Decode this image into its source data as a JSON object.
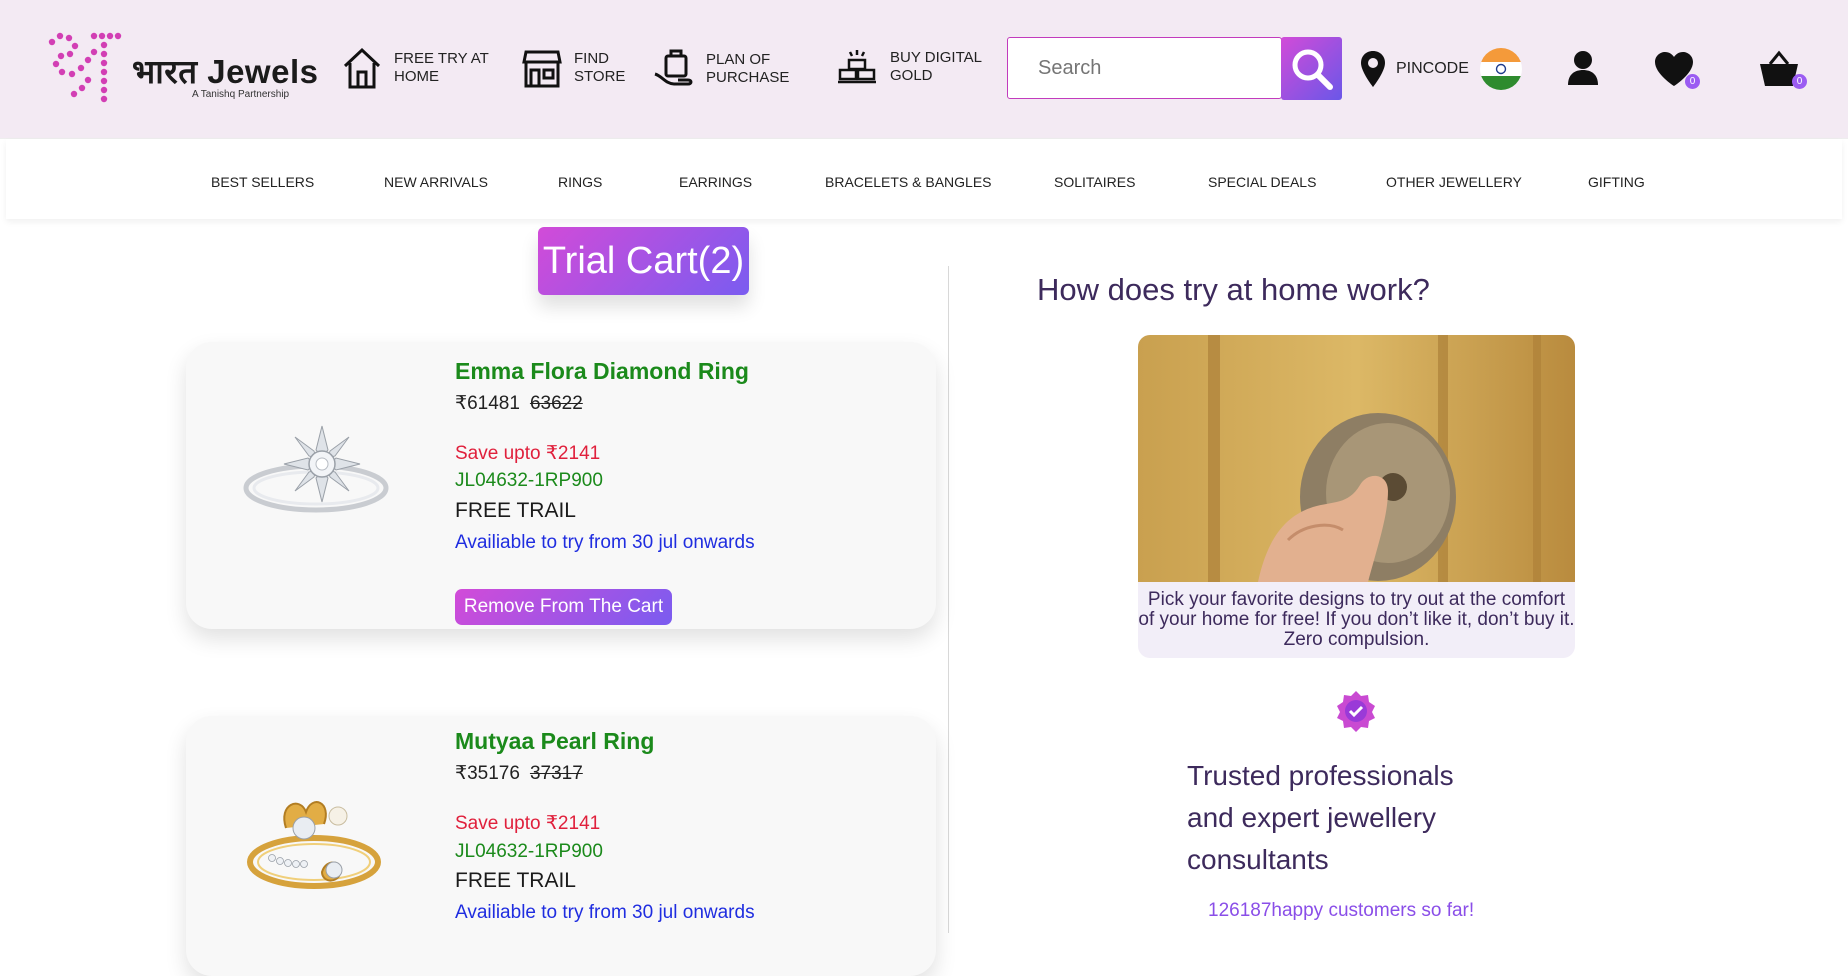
{
  "brand": {
    "logo_text": "भारत Jewels",
    "logo_sub": "A Tanishq Partnership"
  },
  "header": {
    "links": [
      {
        "label1": "FREE TRY AT",
        "label2": "HOME",
        "icon": "home-icon"
      },
      {
        "label1": "FIND",
        "label2": "STORE",
        "icon": "store-icon"
      },
      {
        "label1": "PLAN OF",
        "label2": "PURCHASE",
        "icon": "shopping-bag-hand-icon"
      },
      {
        "label1": "BUY DIGITAL",
        "label2": "GOLD",
        "icon": "gold-bars-icon"
      }
    ],
    "search_placeholder": "Search",
    "pincode_label": "PINCODE",
    "wishlist_count": "0",
    "cart_count": "0"
  },
  "nav": {
    "items": [
      "BEST SELLERS",
      "NEW ARRIVALS",
      "RINGS",
      "EARRINGS",
      "BRACELETS & BANGLES",
      "SOLITAIRES",
      "SPECIAL DEALS",
      "OTHER JEWELLERY",
      "GIFTING"
    ]
  },
  "trial_cart": {
    "button_label": "Trial Cart(2)",
    "items": [
      {
        "name": "Emma Flora Diamond Ring",
        "price": "₹61481",
        "mrp": "63622",
        "save": "Save upto ₹2141",
        "code": "JL04632-1RP900",
        "trail": "FREE TRAIL",
        "availability": "Availiable to try from 30 jul onwards",
        "remove_label": "Remove From The Cart"
      },
      {
        "name": "Mutyaa Pearl Ring",
        "price": "₹35176",
        "mrp": "37317",
        "save": "Save upto ₹2141",
        "code": "JL04632-1RP900",
        "trail": "FREE TRAIL",
        "availability": "Availiable to try from 30 jul onwards"
      }
    ]
  },
  "how_it_works": {
    "title": "How does try at home work?",
    "description": "Pick your favorite designs to try out at the comfort of your home for free! If you don’t like it, don’t buy it. Zero compulsion.",
    "trust_text": "Trusted professionals and expert jewellery consultants",
    "customers_count": "126187",
    "customers_suffix": "happy customers so far!"
  },
  "colors": {
    "accent_gradient_start": "#d24bd8",
    "accent_gradient_end": "#7a5cf0",
    "product_green": "#1b8a1b",
    "save_red": "#e0203c",
    "avail_blue": "#1f2de0",
    "heading_purple": "#3d2a5c"
  }
}
